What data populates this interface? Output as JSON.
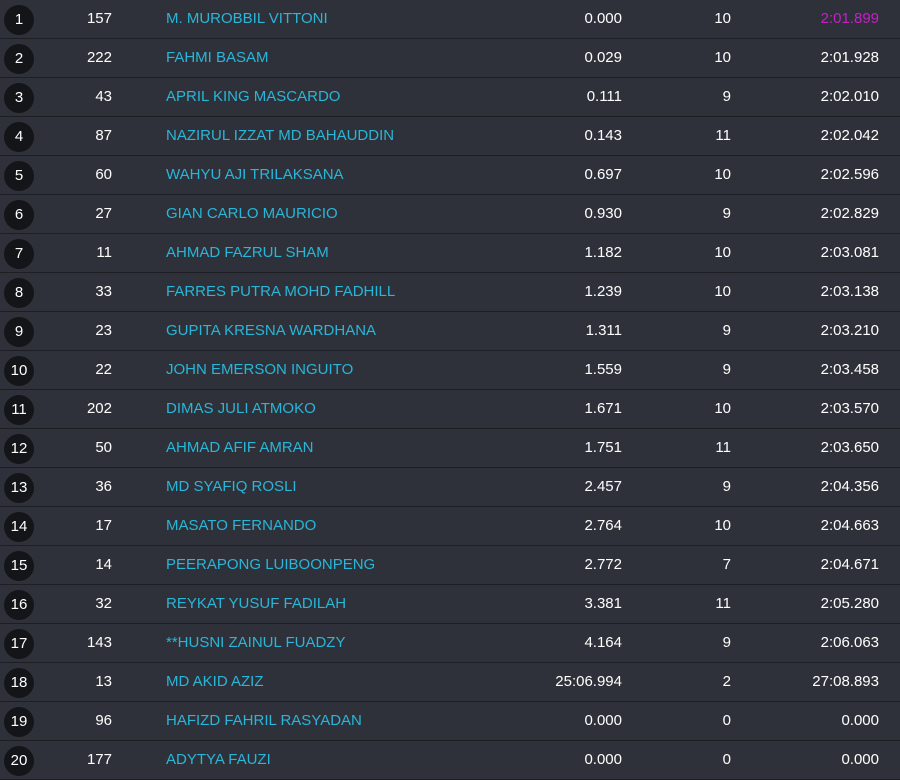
{
  "colors": {
    "background": "#1f2126",
    "row_background": "#2e3139",
    "badge_background": "#141519",
    "text": "#ffffff",
    "name_link": "#29b6d8",
    "fastest_lap": "#c81ec8"
  },
  "rows": [
    {
      "pos": "1",
      "number": "157",
      "name": "M. MUROBBIL VITTONI",
      "gap": "0.000",
      "laps": "10",
      "best_lap": "2:01.899",
      "fastest": true
    },
    {
      "pos": "2",
      "number": "222",
      "name": "FAHMI BASAM",
      "gap": "0.029",
      "laps": "10",
      "best_lap": "2:01.928",
      "fastest": false
    },
    {
      "pos": "3",
      "number": "43",
      "name": "APRIL KING MASCARDO",
      "gap": "0.111",
      "laps": "9",
      "best_lap": "2:02.010",
      "fastest": false
    },
    {
      "pos": "4",
      "number": "87",
      "name": "NAZIRUL IZZAT MD BAHAUDDIN",
      "gap": "0.143",
      "laps": "11",
      "best_lap": "2:02.042",
      "fastest": false
    },
    {
      "pos": "5",
      "number": "60",
      "name": "WAHYU AJI TRILAKSANA",
      "gap": "0.697",
      "laps": "10",
      "best_lap": "2:02.596",
      "fastest": false
    },
    {
      "pos": "6",
      "number": "27",
      "name": "GIAN CARLO MAURICIO",
      "gap": "0.930",
      "laps": "9",
      "best_lap": "2:02.829",
      "fastest": false
    },
    {
      "pos": "7",
      "number": "11",
      "name": "AHMAD FAZRUL SHAM",
      "gap": "1.182",
      "laps": "10",
      "best_lap": "2:03.081",
      "fastest": false
    },
    {
      "pos": "8",
      "number": "33",
      "name": "FARRES PUTRA MOHD FADHILL",
      "gap": "1.239",
      "laps": "10",
      "best_lap": "2:03.138",
      "fastest": false
    },
    {
      "pos": "9",
      "number": "23",
      "name": "GUPITA KRESNA WARDHANA",
      "gap": "1.311",
      "laps": "9",
      "best_lap": "2:03.210",
      "fastest": false
    },
    {
      "pos": "10",
      "number": "22",
      "name": "JOHN EMERSON INGUITO",
      "gap": "1.559",
      "laps": "9",
      "best_lap": "2:03.458",
      "fastest": false
    },
    {
      "pos": "11",
      "number": "202",
      "name": "DIMAS JULI ATMOKO",
      "gap": "1.671",
      "laps": "10",
      "best_lap": "2:03.570",
      "fastest": false
    },
    {
      "pos": "12",
      "number": "50",
      "name": "AHMAD AFIF AMRAN",
      "gap": "1.751",
      "laps": "11",
      "best_lap": "2:03.650",
      "fastest": false
    },
    {
      "pos": "13",
      "number": "36",
      "name": "MD SYAFIQ ROSLI",
      "gap": "2.457",
      "laps": "9",
      "best_lap": "2:04.356",
      "fastest": false
    },
    {
      "pos": "14",
      "number": "17",
      "name": "MASATO FERNANDO",
      "gap": "2.764",
      "laps": "10",
      "best_lap": "2:04.663",
      "fastest": false
    },
    {
      "pos": "15",
      "number": "14",
      "name": "PEERAPONG LUIBOONPENG",
      "gap": "2.772",
      "laps": "7",
      "best_lap": "2:04.671",
      "fastest": false
    },
    {
      "pos": "16",
      "number": "32",
      "name": "REYKAT YUSUF FADILAH",
      "gap": "3.381",
      "laps": "11",
      "best_lap": "2:05.280",
      "fastest": false
    },
    {
      "pos": "17",
      "number": "143",
      "name": "**HUSNI ZAINUL FUADZY",
      "gap": "4.164",
      "laps": "9",
      "best_lap": "2:06.063",
      "fastest": false
    },
    {
      "pos": "18",
      "number": "13",
      "name": "MD AKID AZIZ",
      "gap": "25:06.994",
      "laps": "2",
      "best_lap": "27:08.893",
      "fastest": false
    },
    {
      "pos": "19",
      "number": "96",
      "name": "HAFIZD FAHRIL RASYADAN",
      "gap": "0.000",
      "laps": "0",
      "best_lap": "0.000",
      "fastest": false
    },
    {
      "pos": "20",
      "number": "177",
      "name": "ADYTYA FAUZI",
      "gap": "0.000",
      "laps": "0",
      "best_lap": "0.000",
      "fastest": false
    }
  ]
}
